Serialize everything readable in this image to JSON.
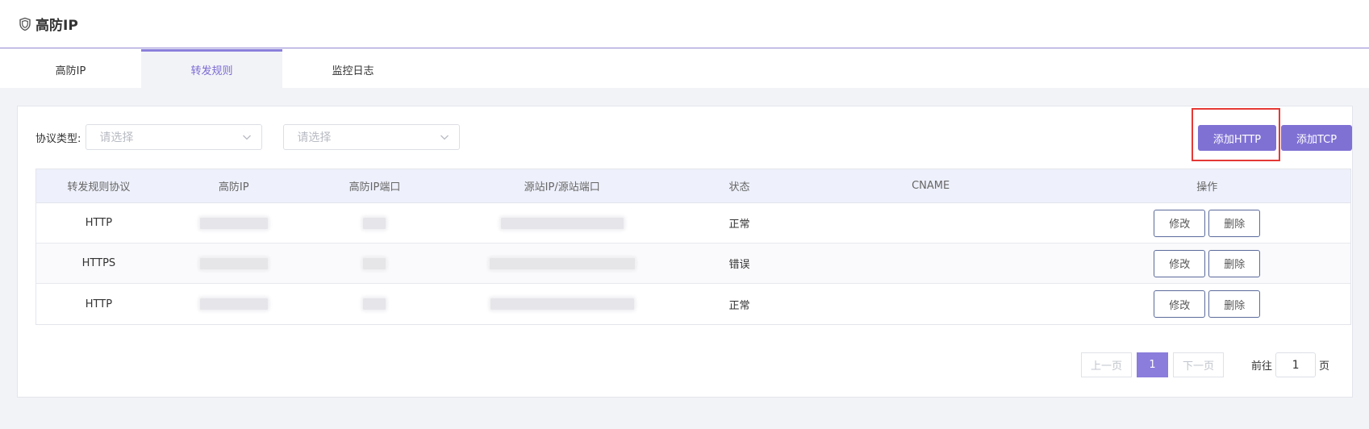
{
  "header": {
    "title": "高防IP"
  },
  "tabs": [
    {
      "label": "高防IP"
    },
    {
      "label": "转发规则",
      "active": true
    },
    {
      "label": "监控日志"
    }
  ],
  "filters": {
    "label": "协议类型:",
    "select1_placeholder": "请选择",
    "select2_placeholder": "请选择"
  },
  "actions": {
    "add_http": "添加HTTP",
    "add_tcp": "添加TCP"
  },
  "table": {
    "columns": [
      "转发规则协议",
      "高防IP",
      "高防IP端口",
      "源站IP/源站端口",
      "状态",
      "CNAME",
      "操作"
    ],
    "rows": [
      {
        "protocol": "HTTP",
        "status": "正常"
      },
      {
        "protocol": "HTTPS",
        "status": "错误"
      },
      {
        "protocol": "HTTP",
        "status": "正常"
      }
    ],
    "edit_label": "修改",
    "delete_label": "删除"
  },
  "pagination": {
    "prev": "上一页",
    "current": "1",
    "next": "下一页",
    "goto_prefix": "前往",
    "goto_value": "1",
    "goto_suffix": "页"
  },
  "colors": {
    "accent": "#7f71d4",
    "highlight": "#e53935"
  }
}
